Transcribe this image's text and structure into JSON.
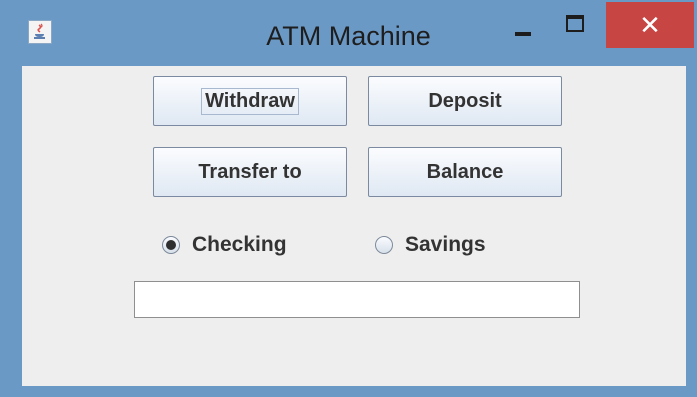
{
  "window": {
    "title": "ATM Machine",
    "close_symbol": "✕"
  },
  "buttons": {
    "withdraw": "Withdraw",
    "deposit": "Deposit",
    "transfer": "Transfer to",
    "balance": "Balance"
  },
  "account_type": {
    "options": [
      "Checking",
      "Savings"
    ],
    "selected": "Checking"
  },
  "amount_field": {
    "value": ""
  },
  "icons": {
    "app": "java-coffee-cup-icon",
    "minimize": "minimize-icon",
    "maximize": "maximize-icon",
    "close": "close-icon"
  }
}
